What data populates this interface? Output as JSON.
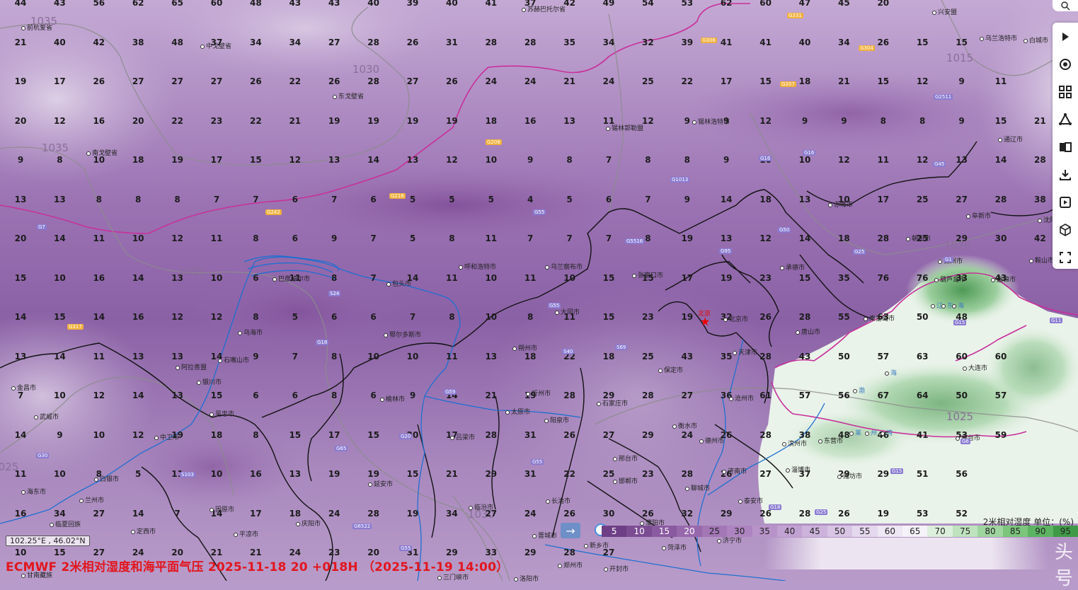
{
  "title": "ECMWF 2米相对湿度和海平面气压 2025-11-18 20 +018H （2025-11-19 14:00）",
  "coords": "102.25°E , 46.02°N",
  "legend": {
    "title": "2米相对湿度 单位：(%)",
    "ticks": [
      "5",
      "10",
      "15",
      "20",
      "25",
      "30",
      "35",
      "40",
      "45",
      "50",
      "55",
      "60",
      "65",
      "70",
      "75",
      "80",
      "85",
      "90",
      "95"
    ],
    "colors": [
      "#6e3f86",
      "#7c4c93",
      "#8a5aa0",
      "#9868ac",
      "#a376b6",
      "#ae84c0",
      "#b893c9",
      "#c2a2d2",
      "#cdb3db",
      "#d8c5e4",
      "#e4d8ee",
      "#eee7f4",
      "#f6f2f9",
      "#dcefdc",
      "#bfe3bf",
      "#9fd59f",
      "#7bc57d",
      "#5cb462",
      "#3f9a47"
    ]
  },
  "watermark": "头号",
  "beijing": "北京",
  "isobars": [
    {
      "label": "1035"
    },
    {
      "label": "1030"
    },
    {
      "label": "1035"
    },
    {
      "label": "1035"
    },
    {
      "label": "1015"
    },
    {
      "label": "1020"
    },
    {
      "label": "1025"
    },
    {
      "label": "1030"
    },
    {
      "label": "025"
    }
  ],
  "highways": [
    "G331",
    "G306",
    "G304",
    "G207",
    "G2511",
    "G1013",
    "G16",
    "G16",
    "G45",
    "G208",
    "G216",
    "G242",
    "G55",
    "G7",
    "G55",
    "G5516",
    "G95",
    "G50",
    "G25",
    "G1",
    "G15",
    "G11",
    "G317",
    "G18",
    "S24",
    "S40",
    "S69",
    "G59",
    "G65",
    "G20",
    "G55",
    "G30",
    "S103",
    "G6522",
    "G55",
    "G25",
    "G18",
    "G15",
    "G6"
  ],
  "cities": [
    {
      "name": "苏赫巴托尔省"
    },
    {
      "name": "中戈壁省"
    },
    {
      "name": "东戈壁省"
    },
    {
      "name": "前杭爱省"
    },
    {
      "name": "南戈壁省"
    },
    {
      "name": "锡林郭勒盟"
    },
    {
      "name": "锡林浩特市"
    },
    {
      "name": "兴安盟"
    },
    {
      "name": "乌兰浩特市"
    },
    {
      "name": "白城市"
    },
    {
      "name": "通辽市"
    },
    {
      "name": "赤峰市"
    },
    {
      "name": "阜新市"
    },
    {
      "name": "沈阳市"
    },
    {
      "name": "朝阳市"
    },
    {
      "name": "锦州市"
    },
    {
      "name": "鞍山市"
    },
    {
      "name": "葫芦岛市"
    },
    {
      "name": "盘锦市"
    },
    {
      "name": "承德市"
    },
    {
      "name": "秦皇岛市"
    },
    {
      "name": "唐山市"
    },
    {
      "name": "北京市"
    },
    {
      "name": "天津市"
    },
    {
      "name": "张家口市"
    },
    {
      "name": "保定市"
    },
    {
      "name": "沧州市"
    },
    {
      "name": "石家庄市"
    },
    {
      "name": "衡水市"
    },
    {
      "name": "邢台市"
    },
    {
      "name": "邯郸市"
    },
    {
      "name": "德州市"
    },
    {
      "name": "济南市"
    },
    {
      "name": "聊城市"
    },
    {
      "name": "泰安市"
    },
    {
      "name": "淄博市"
    },
    {
      "name": "潍坊市"
    },
    {
      "name": "东营市"
    },
    {
      "name": "滨州市"
    },
    {
      "name": "烟台市"
    },
    {
      "name": "大连市"
    },
    {
      "name": "呼和浩特市"
    },
    {
      "name": "乌兰察布市"
    },
    {
      "name": "包头市"
    },
    {
      "name": "鄂尔多斯市"
    },
    {
      "name": "巴彦淖尔市"
    },
    {
      "name": "乌海市"
    },
    {
      "name": "阿拉善盟"
    },
    {
      "name": "石嘴山市"
    },
    {
      "name": "银川市"
    },
    {
      "name": "吴忠市"
    },
    {
      "name": "中卫市"
    },
    {
      "name": "金昌市"
    },
    {
      "name": "武威市"
    },
    {
      "name": "白银市"
    },
    {
      "name": "兰州市"
    },
    {
      "name": "海东市"
    },
    {
      "name": "临夏回族"
    },
    {
      "name": "甘南藏族"
    },
    {
      "name": "定西市"
    },
    {
      "name": "固原市"
    },
    {
      "name": "平凉市"
    },
    {
      "name": "庆阳市"
    },
    {
      "name": "延安市"
    },
    {
      "name": "榆林市"
    },
    {
      "name": "吕梁市"
    },
    {
      "name": "忻州市"
    },
    {
      "name": "朔州市"
    },
    {
      "name": "大同市"
    },
    {
      "name": "太原市"
    },
    {
      "name": "阳泉市"
    },
    {
      "name": "长治市"
    },
    {
      "name": "晋城市"
    },
    {
      "name": "临汾市"
    },
    {
      "name": "新乡市"
    },
    {
      "name": "濮阳市"
    },
    {
      "name": "菏泽市"
    },
    {
      "name": "济宁市"
    },
    {
      "name": "开封市"
    },
    {
      "name": "郑州市"
    },
    {
      "name": "三门峡市"
    },
    {
      "name": "洛阳市"
    }
  ],
  "sea_labels": [
    "渤",
    "海",
    "莱",
    "州",
    "湾",
    "辽",
    "东",
    "海"
  ],
  "grid_values": [
    [
      44,
      43,
      56,
      62,
      65,
      60,
      48,
      43,
      43,
      40,
      39,
      40,
      41,
      37,
      42,
      49,
      54,
      53,
      62,
      60,
      47,
      45,
      20
    ],
    [
      21,
      40,
      42,
      38,
      48,
      37,
      34,
      34,
      27,
      28,
      26,
      31,
      28,
      28,
      35,
      34,
      32,
      39,
      41,
      41,
      40,
      34,
      26,
      15,
      15
    ],
    [
      19,
      17,
      26,
      27,
      27,
      27,
      26,
      22,
      26,
      28,
      27,
      26,
      24,
      24,
      21,
      24,
      25,
      22,
      17,
      15,
      18,
      21,
      15,
      12,
      9,
      11
    ],
    [
      20,
      12,
      16,
      20,
      22,
      23,
      22,
      21,
      19,
      19,
      19,
      19,
      18,
      16,
      13,
      11,
      12,
      9,
      9,
      12,
      9,
      9,
      8,
      8,
      9,
      15,
      21
    ],
    [
      9,
      8,
      10,
      18,
      19,
      17,
      15,
      12,
      13,
      14,
      13,
      12,
      10,
      9,
      8,
      7,
      8,
      8,
      9,
      10,
      10,
      12,
      11,
      12,
      13,
      14,
      28
    ],
    [
      13,
      13,
      8,
      8,
      8,
      7,
      7,
      6,
      7,
      6,
      5,
      5,
      5,
      4,
      5,
      6,
      7,
      9,
      14,
      18,
      13,
      10,
      17,
      25,
      27,
      28,
      38
    ],
    [
      20,
      14,
      11,
      10,
      12,
      11,
      8,
      6,
      9,
      7,
      5,
      8,
      11,
      7,
      7,
      7,
      8,
      19,
      13,
      12,
      14,
      18,
      28,
      25,
      29,
      30,
      42
    ],
    [
      15,
      10,
      16,
      14,
      13,
      10,
      6,
      11,
      8,
      7,
      14,
      11,
      10,
      11,
      10,
      15,
      15,
      17,
      19,
      23,
      15,
      35,
      76,
      76,
      33,
      43
    ],
    [
      14,
      15,
      14,
      16,
      12,
      12,
      8,
      5,
      6,
      6,
      7,
      8,
      10,
      8,
      11,
      15,
      23,
      19,
      32,
      26,
      28,
      55,
      63,
      50,
      48
    ],
    [
      13,
      14,
      11,
      13,
      13,
      14,
      9,
      7,
      8,
      10,
      10,
      11,
      13,
      18,
      22,
      18,
      25,
      43,
      35,
      28,
      43,
      50,
      57,
      63,
      60,
      60
    ],
    [
      7,
      10,
      12,
      14,
      13,
      15,
      6,
      6,
      8,
      6,
      9,
      14,
      21,
      19,
      28,
      29,
      28,
      27,
      36,
      61,
      57,
      56,
      67,
      64,
      50,
      57
    ],
    [
      14,
      9,
      10,
      12,
      19,
      18,
      8,
      15,
      17,
      15,
      20,
      17,
      28,
      31,
      26,
      27,
      29,
      24,
      26,
      28,
      38,
      48,
      46,
      41,
      53,
      59
    ],
    [
      11,
      10,
      8,
      5,
      11,
      10,
      16,
      13,
      19,
      19,
      15,
      21,
      29,
      31,
      22,
      25,
      23,
      28,
      26,
      27,
      37,
      29,
      29,
      51,
      56
    ],
    [
      16,
      34,
      27,
      14,
      7,
      14,
      17,
      18,
      24,
      28,
      19,
      34,
      27,
      24,
      26,
      30,
      26,
      32,
      29,
      26,
      28,
      26,
      19,
      53,
      52
    ],
    [
      10,
      15,
      27,
      24,
      20,
      21,
      21,
      24,
      23,
      20,
      31,
      29,
      33,
      29,
      28,
      27
    ]
  ],
  "toolbar": [
    "layers-icon",
    "grid-icon",
    "route-icon",
    "compare-icon",
    "download-icon",
    "video-icon",
    "cube-icon",
    "fullscreen-icon"
  ]
}
